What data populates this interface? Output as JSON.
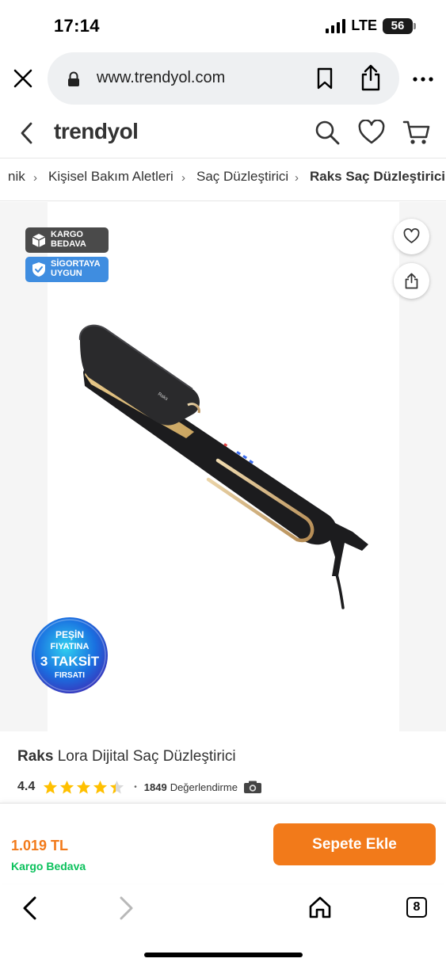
{
  "status_bar": {
    "time": "17:14",
    "network": "LTE",
    "battery": "56"
  },
  "browser": {
    "url": "www.trendyol.com"
  },
  "header": {
    "logo": "trendyol"
  },
  "breadcrumb": {
    "items": [
      "nik",
      "Kişisel Bakım Aletleri",
      "Saç Düzleştirici",
      "Raks Saç Düzleştirici"
    ]
  },
  "badges": {
    "cargo": [
      "KARGO",
      "BEDAVA"
    ],
    "insurance": [
      "SİGORTAYA",
      "UYGUN"
    ]
  },
  "product": {
    "brand": "Raks",
    "name": "Lora Dijital Saç Düzleştirici",
    "device_print": "Raks",
    "rating": "4.4",
    "rating_value": 4.4,
    "review_count": "1849",
    "review_label": "Değerlendirme"
  },
  "promo": {
    "lines": [
      "PEŞİN",
      "FIYATINA",
      "3 TAKSİT",
      "FIRSATI"
    ]
  },
  "purchase": {
    "price": "1.019 TL",
    "shipping": "Kargo Bedava",
    "add_to_cart_label": "Sepete Ekle"
  },
  "toolbar": {
    "tab_count": "8"
  },
  "colors": {
    "accent": "#f27a1a",
    "free_shipping": "#0bc15c",
    "star": "#ffc000",
    "insurance_badge": "#3f8de0",
    "cargo_badge": "#4a4a4a"
  }
}
